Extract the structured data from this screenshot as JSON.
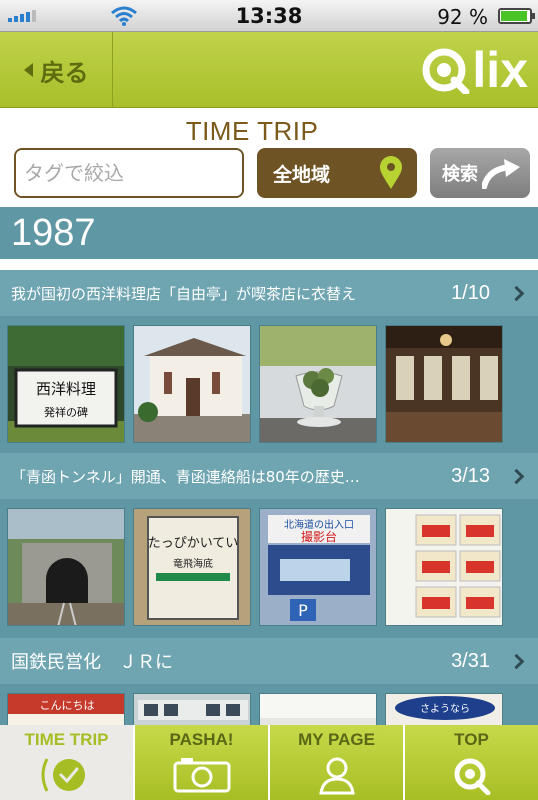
{
  "status_bar": {
    "time": "13:38",
    "battery": "92 %",
    "battery_level": 0.92
  },
  "nav": {
    "back_label": "戻る",
    "logo_text": "lix"
  },
  "search": {
    "title": "TIME TRIP",
    "tag_placeholder": "タグで絞込",
    "tag_button": "#",
    "region_label": "全地域",
    "search_label": "検索"
  },
  "year": "1987",
  "topics": [
    {
      "title": "我が国初の西洋料理店「自由亭」が喫茶店に衣替え",
      "count": "1/10"
    },
    {
      "title": "「青函トンネル」開通、青函連絡船は80年の歴史…",
      "count": "3/13"
    },
    {
      "title": "国鉄民営化　ＪＲに",
      "count": "3/31"
    }
  ],
  "photo_texts": {
    "sign1": "西洋料理",
    "sign2": "発祥の碑",
    "station": "たっぴかいてい",
    "station_sub": "竜飛海底",
    "poster1": "北海道の出入口",
    "poster2": "撮影台",
    "greeting": "こんにちは",
    "goodbye": "さようなら"
  },
  "tabs": [
    {
      "label": "TIME TRIP",
      "icon": "clock-icon"
    },
    {
      "label": "PASHA!",
      "icon": "camera-icon"
    },
    {
      "label": "MY PAGE",
      "icon": "person-icon"
    },
    {
      "label": "TOP",
      "icon": "qlix-logo-icon"
    }
  ],
  "colors": {
    "accent_green": "#a6be23",
    "brown": "#6e5425",
    "teal": "#5f97a4"
  }
}
